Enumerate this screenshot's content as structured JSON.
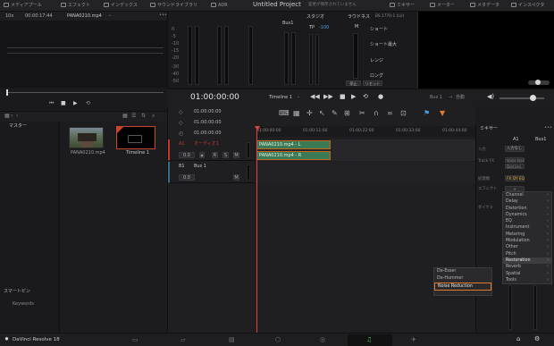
{
  "topbar": {
    "items": [
      {
        "label": "メディアプール",
        "icon": "media-pool-icon"
      },
      {
        "label": "エフェクト",
        "icon": "effects-icon"
      },
      {
        "label": "インデックス",
        "icon": "index-icon"
      },
      {
        "label": "サウンドライブラリ",
        "icon": "sound-library-icon"
      },
      {
        "label": "ADR",
        "icon": "adr-icon"
      }
    ],
    "title": "Untitled Project",
    "subtitle": "変更が保存されていません",
    "right_items": [
      {
        "label": "ミキサー",
        "icon": "mixer-icon"
      },
      {
        "label": "メーター",
        "icon": "meter-icon"
      },
      {
        "label": "メタデータ",
        "icon": "metadata-icon"
      },
      {
        "label": "インスペクタ",
        "icon": "inspector-icon"
      }
    ]
  },
  "viewer": {
    "zoom": "10x",
    "timecode": "00:00:17:44",
    "clip_name": "PANA0210.mp4"
  },
  "meters": {
    "bus_label": "Bus1",
    "studio_label": "スタジオ",
    "tp_label": "TP",
    "tp_value": "-100",
    "loudness_label": "ラウドネス",
    "loudness_standard": "BS.1770-1 (LU)",
    "m_label": "M",
    "short_label": "ショート",
    "short_max_label": "ショート最大",
    "range_label": "レンジ",
    "long_label": "ロング",
    "pause_label": "停止",
    "reset_label": "リセット",
    "scale": [
      "0",
      "-5",
      "-10",
      "-15",
      "-20",
      "-30",
      "-40",
      "-50"
    ]
  },
  "timeline": {
    "timecode": "01:00:00:00",
    "name": "Timeline 1",
    "auto_label": "自動",
    "bus_label": "Bus 1",
    "ruler": [
      "01:00:00:00",
      "01:00:11:00",
      "01:00:22:00",
      "01:00:33:00",
      "01:00:44:00"
    ],
    "sub_timecodes": [
      "01:00:00:00",
      "01:00:00:00",
      "01:00:00:00"
    ],
    "tracks": [
      {
        "id": "A1",
        "name": "オーディオ1",
        "value": "0.0",
        "buttons": [
          "R",
          "S",
          "M"
        ]
      },
      {
        "id": "B1",
        "name": "Bus 1",
        "value": "0.0",
        "buttons": [
          "M"
        ]
      }
    ],
    "clips": [
      "PANA0210.mp4 - L",
      "PANA0210.mp4 - R"
    ]
  },
  "media_pool": {
    "master_label": "マスター",
    "items": [
      {
        "name": "PANA0210.mp4"
      },
      {
        "name": "Timeline 1"
      }
    ],
    "smart_bin_label": "スマートビン",
    "keywords_label": "Keywords"
  },
  "mixer": {
    "title": "ミキサー",
    "columns": [
      "A1",
      "Bus1"
    ],
    "input_label": "入力",
    "input_value": "入力なし",
    "track_fx_label": "Track FX",
    "track_fx_values": [
      "Voice Isol.",
      "Dial Lev."
    ],
    "dynamics_label": "処理順",
    "dynamics_values": [
      "FX",
      "DY",
      "EQ"
    ],
    "effects_label": "エフェクト",
    "dialog_label": "ダイナミ"
  },
  "effects_menu": {
    "items": [
      {
        "label": "Channel",
        "arrow": true
      },
      {
        "label": "Delay",
        "arrow": true
      },
      {
        "label": "Distortion",
        "arrow": true
      },
      {
        "label": "Dynamics",
        "arrow": true
      },
      {
        "label": "EQ",
        "arrow": true
      },
      {
        "label": "Instrument",
        "arrow": true
      },
      {
        "label": "Metering",
        "arrow": true
      },
      {
        "label": "Modulation",
        "arrow": true
      },
      {
        "label": "Other",
        "arrow": true
      },
      {
        "label": "Pitch",
        "arrow": true
      },
      {
        "label": "Restoration",
        "arrow": true,
        "highlight": true
      },
      {
        "label": "Reverb",
        "arrow": true
      },
      {
        "label": "Spatial",
        "arrow": true
      },
      {
        "label": "Tools",
        "arrow": true
      }
    ],
    "submenu": [
      {
        "label": "De-Esser"
      },
      {
        "label": "De-Hummer"
      },
      {
        "label": "Noise Reduction",
        "selected": true
      }
    ]
  },
  "bottombar": {
    "app_name": "DaVinci Resolve 18",
    "pages": [
      "media",
      "cut",
      "edit",
      "fusion",
      "color",
      "fairlight",
      "deliver"
    ],
    "active_page": "fairlight"
  },
  "colors": {
    "accent_orange": "#e07a2f",
    "clip_green": "#3c7a55",
    "track_red": "#c0392b",
    "playhead": "#e0453a",
    "fairlight_green": "#4ec27a"
  }
}
